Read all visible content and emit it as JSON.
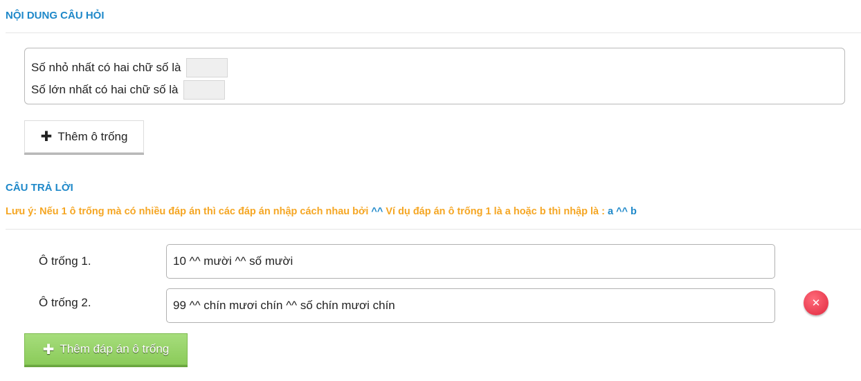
{
  "question_section": {
    "title": "NỘI DUNG CÂU HỎI",
    "lines": [
      "Số nhỏ nhất có hai chữ số là",
      "Số lớn nhất có hai chữ số là"
    ],
    "add_blank_label": "Thêm ô trống"
  },
  "answer_section": {
    "title": "CÂU TRẢ LỜI",
    "note_prefix": "Lưu ý: Nếu 1 ô trống mà có nhiều đáp án thì các đáp án nhập cách nhau bởi ",
    "note_sep": "^^",
    "note_middle": " Ví dụ đáp án ô trống 1 là a hoặc b thì nhập là : ",
    "note_example": "a ^^ b",
    "answers": [
      {
        "label": "Ô trống 1.",
        "value": "10 ^^ mười ^^ số mười"
      },
      {
        "label": "Ô trống 2.",
        "value": "99 ^^ chín mươi chín ^^ số chín mươi chín"
      }
    ],
    "add_answer_label": "Thêm đáp án ô trống"
  },
  "colors": {
    "title_blue": "#1e88c9",
    "note_orange": "#f5a623",
    "add_answer_green": "#8bcb5a",
    "delete_red": "#e0283e"
  },
  "icons": [
    "plus-icon",
    "close-icon"
  ]
}
